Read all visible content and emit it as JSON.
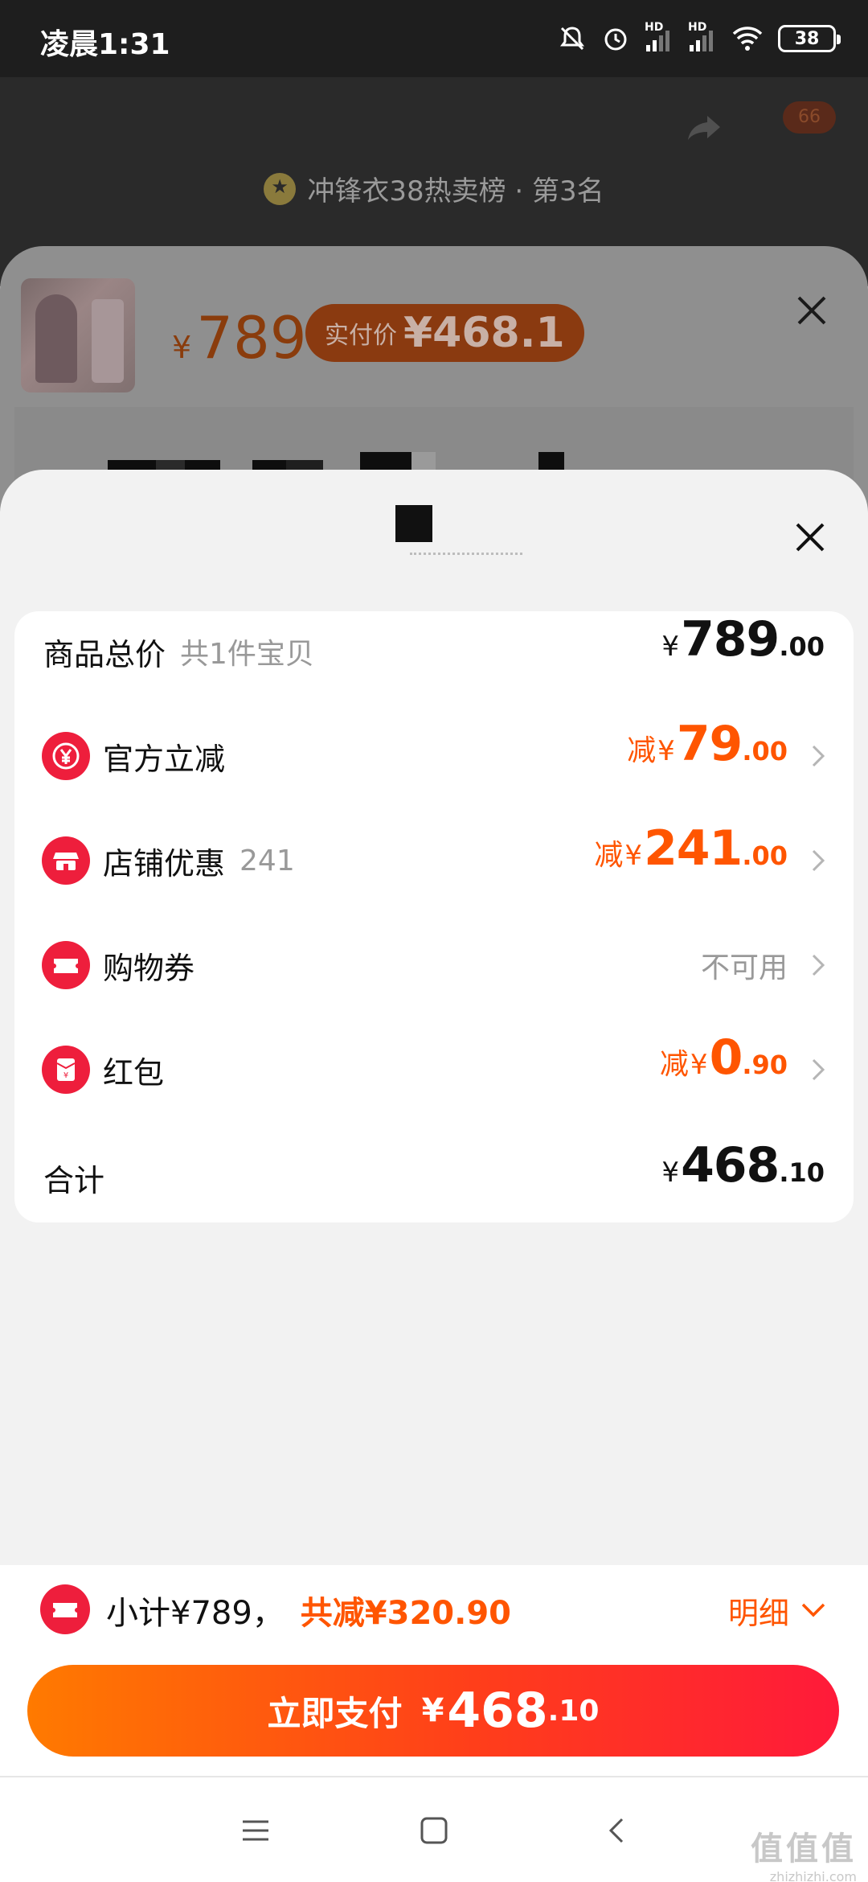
{
  "status_bar": {
    "time": "凌晨1:31",
    "hd1": "HD",
    "hd2": "HD",
    "battery": "38"
  },
  "background": {
    "rank_text": "冲锋衣38热卖榜 · 第3名",
    "badge": "66"
  },
  "sku_sheet": {
    "currency": "¥",
    "price": "789",
    "real_price_label": "实付价",
    "real_price": "¥468.1"
  },
  "discount_sheet": {
    "rows": [
      {
        "label": "商品总价",
        "sub": "共1件宝贝",
        "yen": "¥",
        "int": "789",
        "dec": ".00"
      },
      {
        "label": "官方立减",
        "prefix": "减",
        "yen": "¥",
        "int": "79",
        "dec": ".00"
      },
      {
        "label": "店铺优惠",
        "sub": "241",
        "prefix": "减",
        "yen": "¥",
        "int": "241",
        "dec": ".00"
      },
      {
        "label": "购物券",
        "status": "不可用"
      },
      {
        "label": "红包",
        "prefix": "减",
        "yen": "¥",
        "int": "0",
        "dec": ".90"
      },
      {
        "label": "合计",
        "yen": "¥",
        "int": "468",
        "dec": ".10"
      }
    ]
  },
  "bottom": {
    "subtotal": "小计¥789，",
    "saved": "共减¥320.90",
    "detail": "明细",
    "pay_label": "立即支付",
    "pay_yen": "¥",
    "pay_int": "468",
    "pay_dec": ".10"
  },
  "watermark": {
    "big": "值值值",
    "small": "zhizhizhi.com"
  },
  "colors": {
    "accent": "#ff5500",
    "red_icon": "#ee1e3c",
    "pay_gradient_start": "#ff7a00",
    "pay_gradient_end": "#ff1a3a"
  }
}
